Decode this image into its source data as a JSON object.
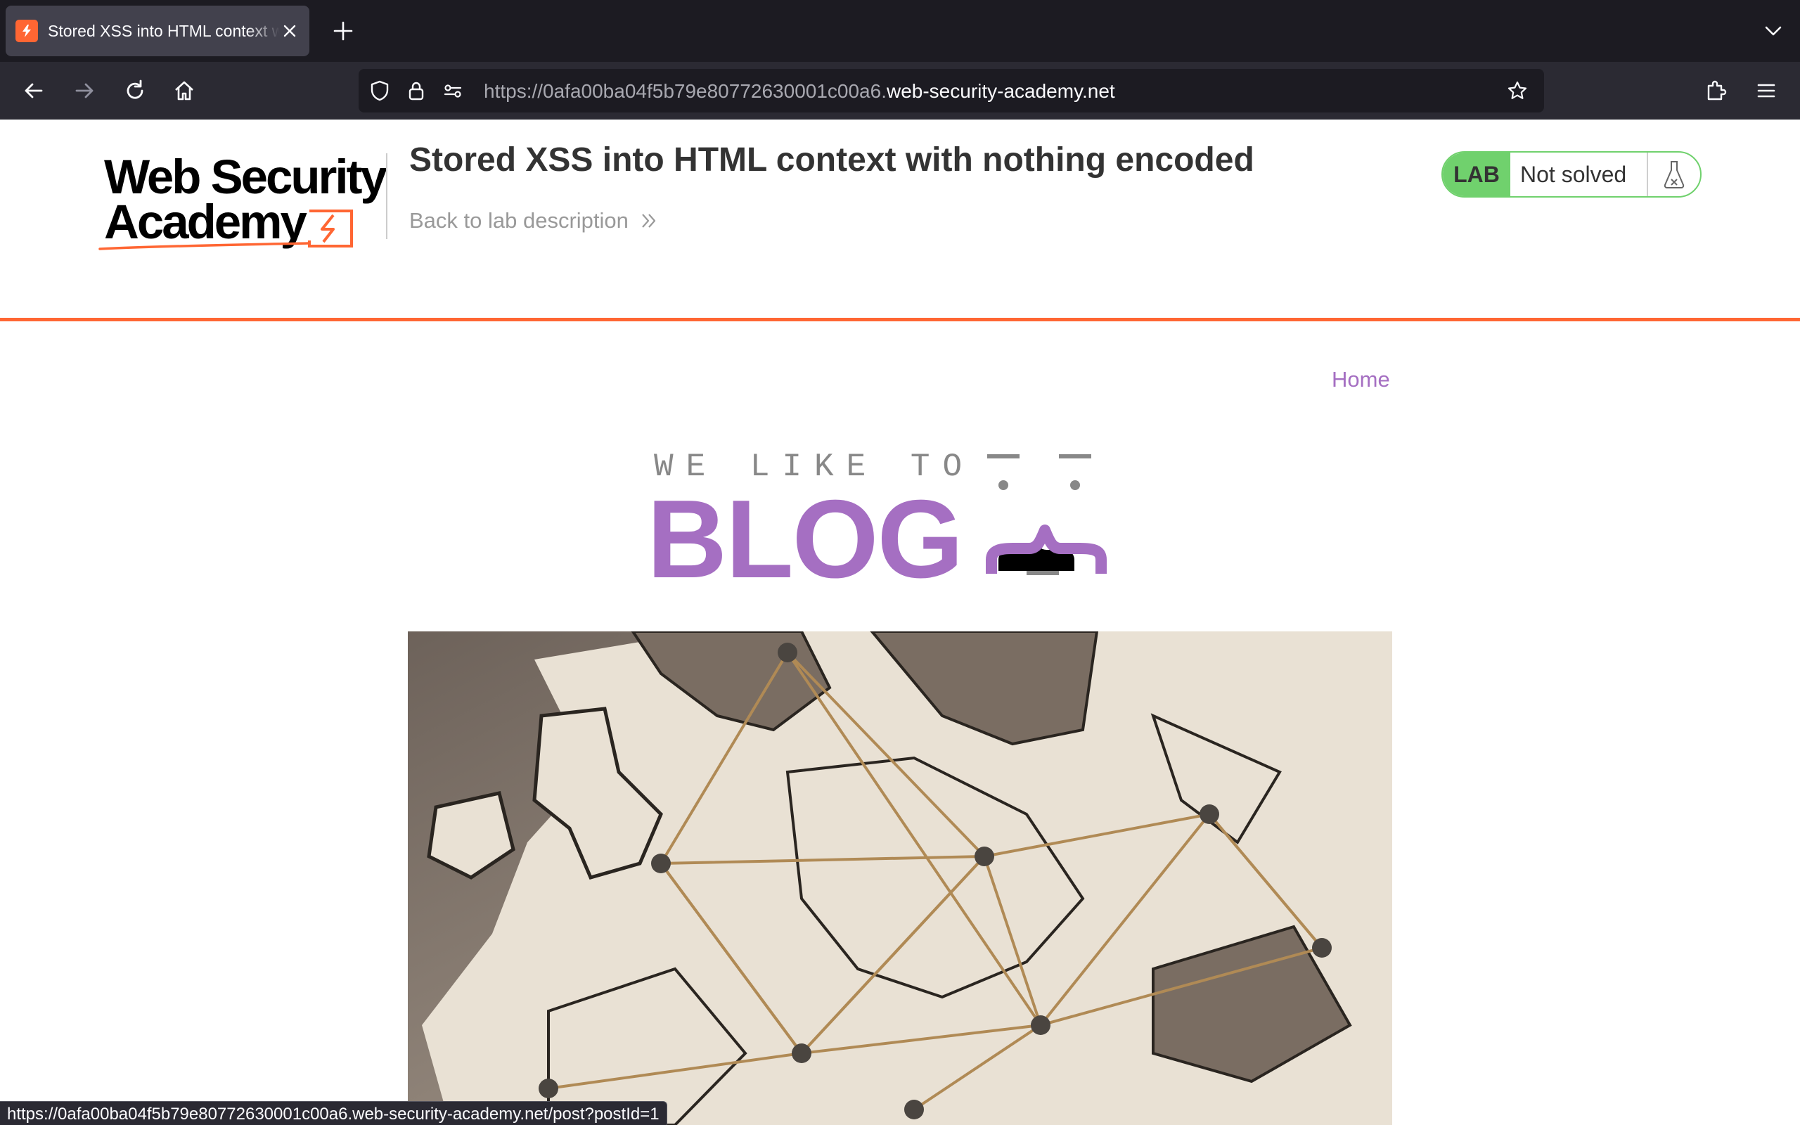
{
  "browser": {
    "tab_title": "Stored XSS into HTML context with nothing encoded",
    "url_prefix": "https://0afa00ba04f5b79e80772630001c00a6.",
    "url_domain": "web-security-academy.net",
    "status_url": "https://0afa00ba04f5b79e80772630001c00a6.web-security-academy.net/post?postId=1"
  },
  "lab": {
    "logo_line1": "Web Security",
    "logo_line2": "Academy",
    "title": "Stored XSS into HTML context with nothing encoded",
    "back_link": "Back to lab description",
    "badge": "LAB",
    "status": "Not solved"
  },
  "blog": {
    "nav_home": "Home",
    "banner_top": "WE LIKE TO",
    "banner_word": "BLOG"
  },
  "colors": {
    "accent_orange": "#ff6633",
    "lab_green": "#70d16d",
    "blog_purple": "#a56fc2"
  }
}
